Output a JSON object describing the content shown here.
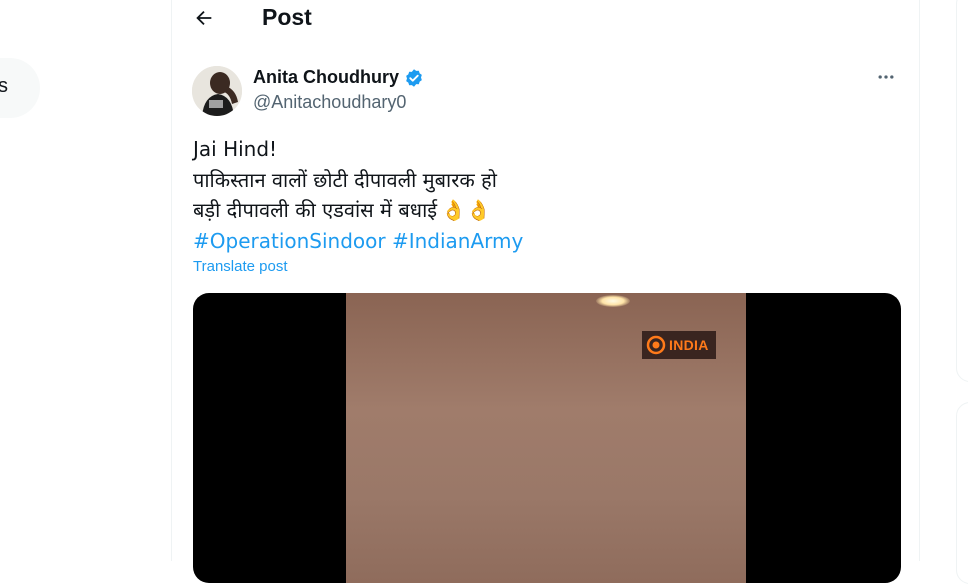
{
  "header": {
    "title": "Post",
    "back_icon": "arrow-left-icon"
  },
  "left_nav": {
    "partial_label": "s"
  },
  "post": {
    "author_name": "Anita Choudhury",
    "author_handle": "@Anitachoudhary0",
    "verified": true,
    "lines": [
      "Jai Hind!",
      "पाकिस्तान वालों छोटी दीपावली मुबारक हो",
      "बड़ी दीपावली की एडवांस में बधाई"
    ],
    "emoji": "👌👌",
    "hashtags": [
      "#OperationSindoor",
      "#IndianArmy"
    ],
    "translate_label": "Translate post",
    "media": {
      "watermark": "INDIA"
    }
  },
  "colors": {
    "link": "#1d9bf0",
    "verified": "#1d9bf0",
    "secondary_text": "#536471"
  }
}
